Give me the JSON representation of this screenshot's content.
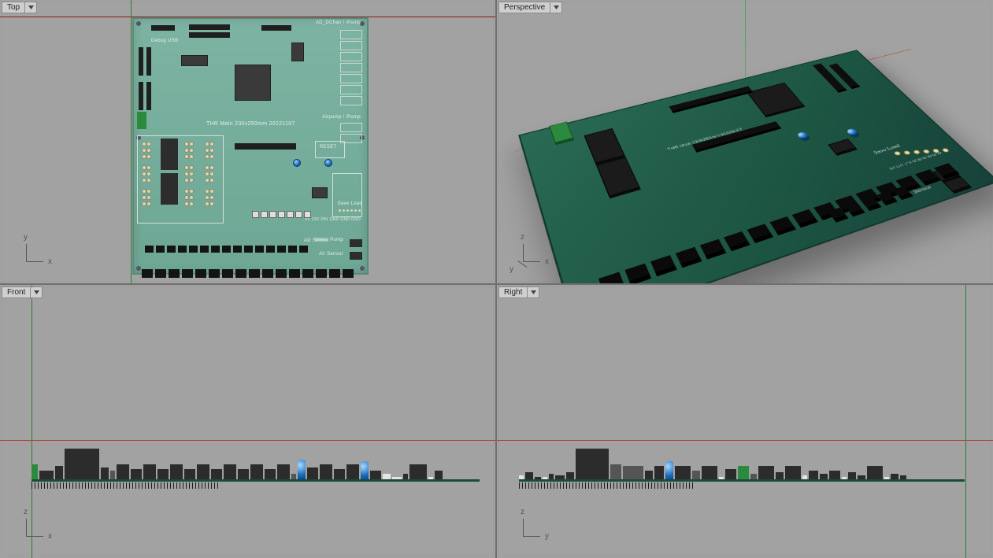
{
  "viewports": {
    "top": {
      "label": "Top",
      "gizmo": {
        "up": "y",
        "right": "x"
      }
    },
    "perspective": {
      "label": "Perspective",
      "gizmo": {
        "up": "z",
        "right": "x",
        "diag": "y"
      }
    },
    "front": {
      "label": "Front",
      "gizmo": {
        "up": "z",
        "right": "x"
      }
    },
    "right": {
      "label": "Right",
      "gizmo": {
        "up": "z",
        "right": "y"
      }
    }
  },
  "pcb": {
    "title_silk": "THR Main 230x250mm 20221107",
    "labels": {
      "debug_usb": "Debug USB",
      "save_load": "Save Load",
      "water_pump": "Water Pump",
      "air_sensor": "Air Sensor",
      "ad_sensor": "AD Sensor",
      "reset": "RESET",
      "pads_row": "5V  12V  24V  GND  GND  GND",
      "ad_chan_ipump": "AD_DChan / iPump",
      "air_pump_ipump": "Airpump / iPump"
    }
  },
  "colors": {
    "pcb_top": "#7db3a2",
    "pcb_persp": "#1d5543",
    "capacitor": "#1d6fc4",
    "terminal_green": "#2c8a3e"
  }
}
